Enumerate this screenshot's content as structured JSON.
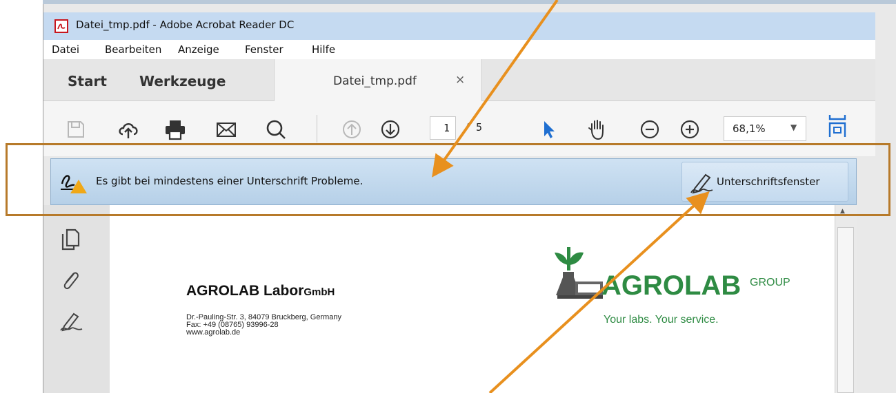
{
  "window": {
    "title": "Datei_tmp.pdf - Adobe Acrobat Reader DC"
  },
  "menu": {
    "items": [
      "Datei",
      "Bearbeiten",
      "Anzeige",
      "Fenster",
      "Hilfe"
    ]
  },
  "tabs": {
    "start": "Start",
    "tools": "Werkzeuge",
    "document": "Datei_tmp.pdf",
    "close": "×"
  },
  "toolbar": {
    "page_current": "1",
    "page_total": "/ 5",
    "zoom": "68,1%",
    "icons": [
      "save-icon",
      "cloud-upload-icon",
      "print-icon",
      "email-icon",
      "search-icon",
      "page-up-icon",
      "page-down-icon",
      "select-arrow-icon",
      "hand-icon",
      "zoom-out-icon",
      "zoom-in-icon",
      "fit-page-icon"
    ]
  },
  "signature_bar": {
    "message": "Es gibt bei mindestens einer Unterschrift Probleme.",
    "button_label": "Unterschriftsfenster"
  },
  "left_panel": {
    "icons": [
      "pages-icon",
      "attachment-icon",
      "signature-icon"
    ]
  },
  "document": {
    "company_name": "AGROLAB Labor",
    "company_suffix": "GmbH",
    "address_lines": [
      "Dr.-Pauling-Str. 3, 84079 Bruckberg, Germany",
      "Fax: +49 (08765) 93996-28",
      "www.agrolab.de"
    ],
    "logo_text": "AGROLAB",
    "logo_group": "GROUP",
    "logo_tagline": "Your labs. Your service."
  },
  "colors": {
    "annotation_arrow": "#e8901e",
    "highlight_box": "#b77a2a",
    "logo_green": "#2e8b43",
    "select_arrow_blue": "#1f6fd1"
  }
}
